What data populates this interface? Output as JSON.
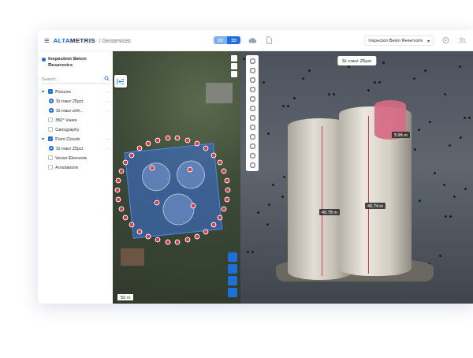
{
  "topbar": {
    "menu_icon": "≡",
    "logo_accent": "ALTA",
    "logo_rest": "METRIS",
    "app": "/ Geoservices",
    "view_modes": [
      {
        "label": "2D",
        "selected": false
      },
      {
        "label": "3D",
        "selected": true
      }
    ],
    "project_select": "Inspection Beton Reservoirs",
    "project_caret": "▾"
  },
  "sidebar": {
    "title": "Inspection Beton Reservoirs",
    "search": {
      "placeholder": "Search..."
    },
    "items": [
      {
        "kind": "group",
        "label": "Pictures",
        "caret": "▾",
        "expanded": true,
        "checked": true,
        "menu": "···",
        "children": [
          {
            "label": "St maur 25pct",
            "selected": true,
            "menu": "···"
          },
          {
            "label": "St maur orth...",
            "selected": true,
            "menu": "···"
          }
        ]
      },
      {
        "kind": "toggle",
        "label": "360° Views",
        "checked": false
      },
      {
        "kind": "toggle",
        "label": "Cartography",
        "checked": false
      },
      {
        "kind": "group",
        "label": "Point Clouds",
        "caret": "▾",
        "expanded": true,
        "checked": true,
        "menu": "···",
        "children": [
          {
            "label": "St maur 25pct",
            "selected": true,
            "menu": "···"
          }
        ]
      },
      {
        "kind": "toggle",
        "label": "Vector Elements",
        "checked": false
      },
      {
        "kind": "toggle",
        "label": "Annotations",
        "checked": false
      }
    ]
  },
  "map": {
    "scale": "50 m"
  },
  "viewer": {
    "title": "St maur 25pct",
    "measurements": [
      {
        "text": "40.78 m"
      },
      {
        "text": "40.74 m"
      },
      {
        "text": "5.96 m"
      }
    ]
  }
}
